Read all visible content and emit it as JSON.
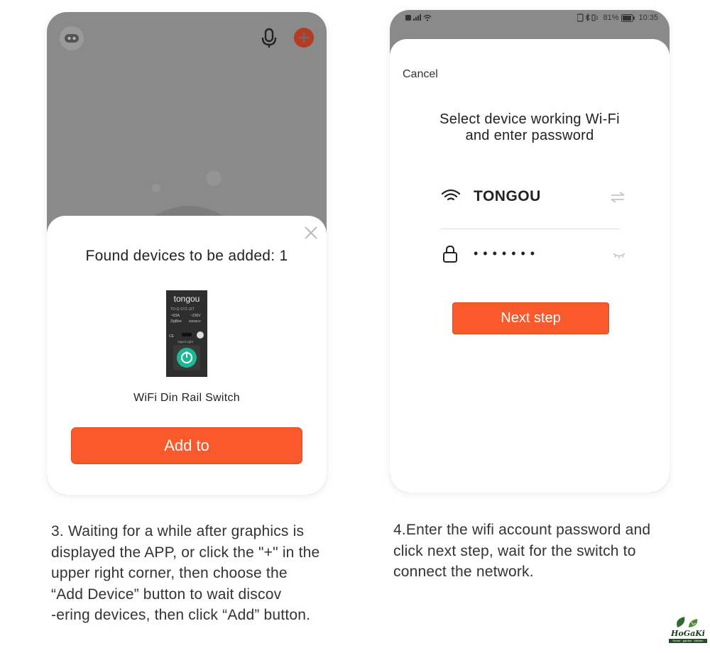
{
  "left_screen": {
    "dialog_title": "Found devices to be added: 1",
    "device": {
      "name": "WiFi Din Rail Switch",
      "image_brand": "tongou",
      "image_model": "TO-Q-SY2-JZT",
      "image_rating": "~63A",
      "image_voltage": "~230V",
      "image_protocol": "ZigBee",
      "image_freq": "50/60Hz",
      "image_signal": "Signal Light"
    },
    "add_button_label": "Add to",
    "icons": [
      "robot-icon",
      "microphone-icon",
      "plus-icon",
      "close-icon"
    ]
  },
  "right_screen": {
    "status_bar": {
      "battery": "81%",
      "time": "10:35"
    },
    "cancel_label": "Cancel",
    "title_line1": "Select device working Wi-Fi",
    "title_line2": "and enter password",
    "wifi_name": "TONGOU",
    "password_mask": "•••••••",
    "next_button_label": "Next step",
    "icons": [
      "wifi-icon",
      "swap-icon",
      "lock-icon",
      "eye-closed-icon"
    ]
  },
  "captions": {
    "left": "3. Waiting for a while after graphics is\ndisplayed the APP, or click the \"+\" in the\nupper right corner, then choose the\n“Add Device” button to wait discov\n-ering devices, then click “Add” button.",
    "right": "4.Enter the wifi account password and\nclick next step, wait for the switch to\nconnect the network."
  },
  "logo": {
    "text": "HoGaKi",
    "tagline": "Home · garden · kitchen"
  },
  "colors": {
    "accent": "#fa5a2b",
    "overlay": "#8a8a8a",
    "device_green": "#1db893"
  }
}
